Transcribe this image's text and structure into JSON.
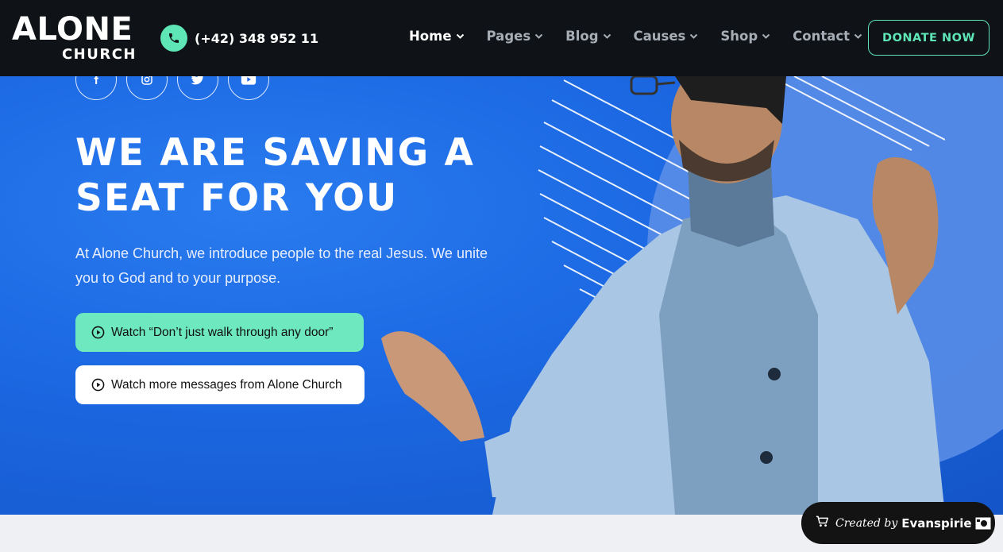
{
  "brand": {
    "name": "ALONE",
    "sub": "CHURCH"
  },
  "contact": {
    "phone": "(+42) 348 952 11",
    "icon": "phone-icon"
  },
  "nav": {
    "items": [
      {
        "label": "Home",
        "active": true
      },
      {
        "label": "Pages",
        "active": false
      },
      {
        "label": "Blog",
        "active": false
      },
      {
        "label": "Causes",
        "active": false
      },
      {
        "label": "Shop",
        "active": false
      },
      {
        "label": "Contact",
        "active": false
      }
    ],
    "donate_label": "DONATE NOW"
  },
  "social": [
    "facebook-icon",
    "instagram-icon",
    "twitter-icon",
    "youtube-icon"
  ],
  "hero": {
    "title_line1": "WE ARE SAVING A",
    "title_line2": "SEAT FOR YOU",
    "subtitle": "At Alone Church, we introduce people to the real Jesus. We unite you to God and to your purpose.",
    "button_watch": "Watch “Don’t just walk through any door”",
    "button_more": "Watch more messages from Alone Church"
  },
  "badge": {
    "prefix": "Created by",
    "brand": "Evanspirie"
  },
  "colors": {
    "header_bg": "#0f1318",
    "accent": "#5ee6b6",
    "hero_blue": "#1c69e3",
    "footer_bg": "#eef0f4"
  }
}
